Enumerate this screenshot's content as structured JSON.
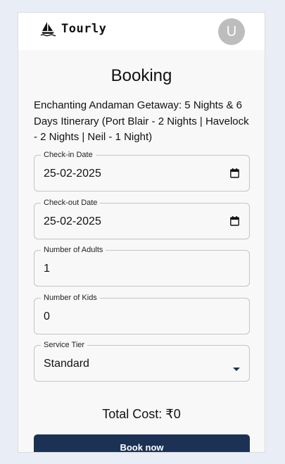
{
  "header": {
    "brand_name": "Tourly",
    "avatar_initial": "U"
  },
  "page": {
    "title": "Booking",
    "tour_name": "Enchanting Andaman Getaway: 5 Nights & 6 Days Itinerary (Port Blair - 2 Nights | Havelock - 2 Nights | Neil - 1 Night)"
  },
  "form": {
    "checkin": {
      "label": "Check-in Date",
      "value": "25-02-2025"
    },
    "checkout": {
      "label": "Check-out Date",
      "value": "25-02-2025"
    },
    "adults": {
      "label": "Number of Adults",
      "value": "1"
    },
    "kids": {
      "label": "Number of Kids",
      "value": "0"
    },
    "tier": {
      "label": "Service Tier",
      "value": "Standard"
    }
  },
  "summary": {
    "total": "Total Cost: ₹0"
  },
  "actions": {
    "book_label": "Book now"
  },
  "colors": {
    "primary": "#1c3254",
    "avatar": "#bdbdbd",
    "background": "#e9edf5"
  }
}
